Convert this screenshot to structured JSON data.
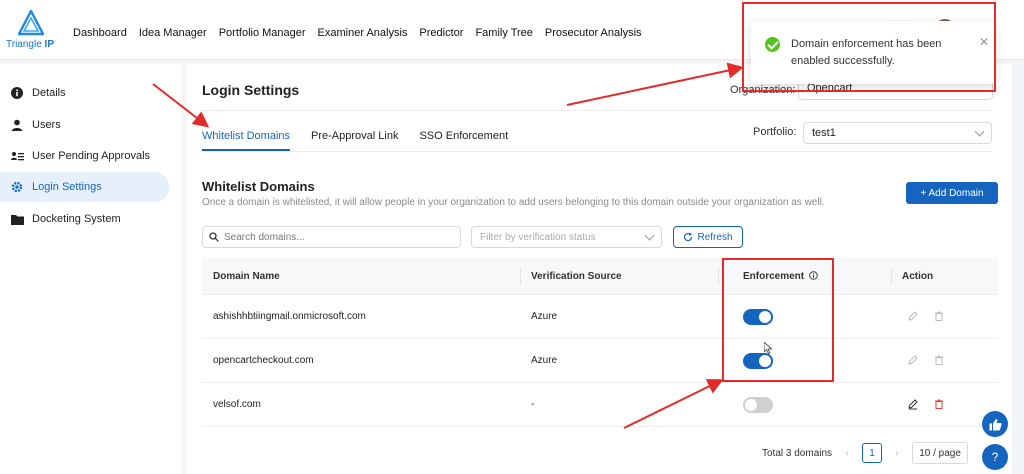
{
  "brand": {
    "name": "Triangle",
    "suffix": "IP"
  },
  "nav": [
    "Dashboard",
    "Idea Manager",
    "Portfolio Manager",
    "Examiner Analysis",
    "Predictor",
    "Family Tree",
    "Prosecutor Analysis"
  ],
  "sidebar": {
    "items": [
      {
        "label": "Details",
        "icon": "info-icon"
      },
      {
        "label": "Users",
        "icon": "user-icon"
      },
      {
        "label": "User Pending Approvals",
        "icon": "user-list-icon"
      },
      {
        "label": "Login Settings",
        "icon": "gear-icon",
        "active": true
      },
      {
        "label": "Docketing System",
        "icon": "folder-icon"
      }
    ]
  },
  "page": {
    "title": "Login Settings",
    "organization_label": "Organization:",
    "organization_value": "Opencart",
    "portfolio_label": "Portfolio:",
    "portfolio_value": "test1"
  },
  "tabs": [
    {
      "label": "Whitelist Domains",
      "active": true
    },
    {
      "label": "Pre-Approval Link"
    },
    {
      "label": "SSO Enforcement"
    }
  ],
  "section": {
    "title": "Whitelist Domains",
    "description": "Once a domain is whitelisted, it will allow people in your organization to add users belonging to this domain outside your organization as well.",
    "add_button": "+ Add Domain"
  },
  "controls": {
    "search_placeholder": "Search domains...",
    "filter_placeholder": "Filter by verification status",
    "refresh_label": "Refresh"
  },
  "table": {
    "headers": [
      "Domain Name",
      "Verification Source",
      "Enforcement",
      "Action"
    ],
    "rows": [
      {
        "domain": "ashishhbtiingmail.onmicrosoft.com",
        "source": "Azure",
        "enforced": true
      },
      {
        "domain": "opencartcheckout.com",
        "source": "Azure",
        "enforced": true
      },
      {
        "domain": "velsof.com",
        "source": "-",
        "enforced": false
      }
    ]
  },
  "pagination": {
    "total": "Total 3 domains",
    "page": "1",
    "page_size": "10 / page"
  },
  "toast": {
    "message": "Domain enforcement has been enabled successfully."
  },
  "fab": {
    "help": "?"
  },
  "colors": {
    "primary": "#1565c0",
    "success": "#52c41a",
    "annotation": "#e32b2b"
  }
}
